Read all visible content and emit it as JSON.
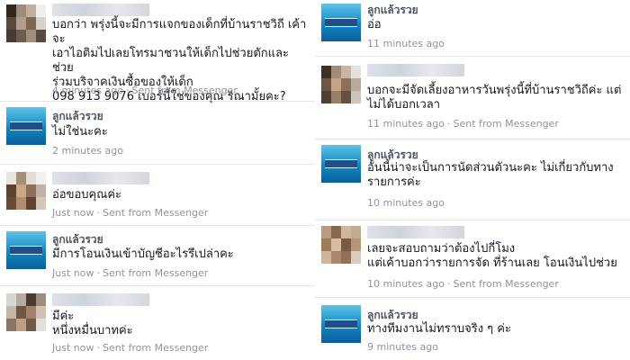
{
  "left_messages": [
    {
      "sender": "",
      "text": "บอกว่า พรุ่งนี้จะมีการแจกของเด็กที่บ้านราชวิถี เค้าจะ\nเอาไอติมไปเลยโทรมาชวนให้เด็กไปช่วยตักและช่วย\nร่วมบริจาคเงินซื้อของให้เด็ก\n098 913 9076 เบอร์นี้ใช่ของคุณ ริณามั้ยคะ?",
      "time": "4 minutes ago",
      "source": "Sent from Messenger"
    },
    {
      "sender": "ลูกแล้วรวย",
      "text": "ไม่ใช่นะคะ",
      "time": "2 minutes ago",
      "source": ""
    },
    {
      "sender": "",
      "text": "อ่อขอบคุณค่ะ",
      "time": "Just now",
      "source": "Sent from Messenger"
    },
    {
      "sender": "ลูกแล้วรวย",
      "text": "มีการโอนเงินเข้าบัญชีอะไรรึเปล่าคะ",
      "time": "Just now",
      "source": "Sent from Messenger"
    },
    {
      "sender": "",
      "text": "มีค่ะ\nหนึ่งหมื่นบาทค่ะ",
      "time": "Just now",
      "source": "Sent from Messenger"
    }
  ],
  "right_messages": [
    {
      "sender": "ลูกแล้วรวย",
      "text": "อ่อ",
      "time": "11 minutes ago",
      "source": ""
    },
    {
      "sender": "",
      "text": "บอกจะมีจัดเลี้ยงอาหารวันพรุ่งนี้ที่บ้านราชวิถีค่ะ แต่\nไม่ได้บอกเวลา",
      "time": "11 minutes ago",
      "source": "Sent from Messenger"
    },
    {
      "sender": "ลูกแล้วรวย",
      "text": "อันนี้น่าจะเป็นการนัดส่วนตัวนะคะ ไม่เกี่ยวกับทาง\nรายการค่ะ",
      "time": "10 minutes ago",
      "source": ""
    },
    {
      "sender": "",
      "text": "เลยจะสอบถามว่าต้องไปกี่โมง\nแต่เค้าบอกว่ารายการจัด ที่ร้านเลย โอนเงินไปช่วย",
      "time": "10 minutes ago",
      "source": "Sent from Messenger"
    },
    {
      "sender": "ลูกแล้วรวย",
      "text": "ทางทีมงานไม่ทราบจริง ๆ ค่ะ",
      "time": "9 minutes ago",
      "source": ""
    }
  ],
  "separator": "·",
  "colors": {
    "text": "#141823",
    "meta": "#90949c",
    "name": "#4e5665",
    "divider": "#e5e6e9",
    "brand_avatar": "#0f86c6"
  }
}
